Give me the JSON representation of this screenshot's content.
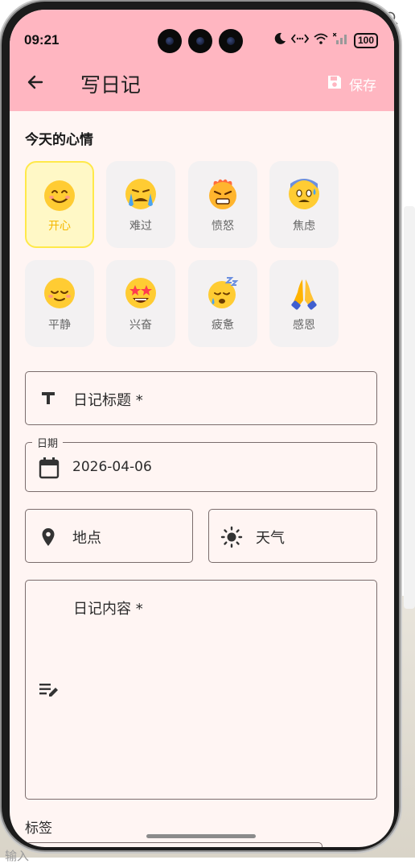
{
  "status_bar": {
    "time": "09:21",
    "battery": "100",
    "icons": [
      "moon-icon",
      "data-transfer-icon",
      "wifi-icon",
      "signal-icon",
      "battery-icon"
    ]
  },
  "header": {
    "title": "写日记",
    "save_label": "保存",
    "back_icon": "arrow-left-icon",
    "save_icon": "floppy-disk-icon",
    "background": "#ffb6c1"
  },
  "mood_section": {
    "title": "今天的心情",
    "moods": [
      {
        "emoji": "😊",
        "label": "开心",
        "selected": true
      },
      {
        "emoji": "😭",
        "label": "难过",
        "selected": false
      },
      {
        "emoji": "🤬",
        "label": "愤怒",
        "selected": false
      },
      {
        "emoji": "😰",
        "label": "焦虑",
        "selected": false
      },
      {
        "emoji": "😌",
        "label": "平静",
        "selected": false
      },
      {
        "emoji": "🤩",
        "label": "兴奋",
        "selected": false
      },
      {
        "emoji": "😴",
        "label": "疲惫",
        "selected": false
      },
      {
        "emoji": "🙏",
        "label": "感恩",
        "selected": false
      }
    ],
    "selected_color": "#ffe94a"
  },
  "form": {
    "title_placeholder": "日记标题 *",
    "date_label": "日期",
    "date_value": "2026-04-06",
    "location_placeholder": "地点",
    "weather_placeholder": "天气",
    "content_placeholder": "日记内容 *",
    "tags_label": "标签"
  },
  "background_bleed": {
    "text": "输入"
  },
  "theme": {
    "page_background": "#fff5f3",
    "border": "#7a6c6c"
  }
}
